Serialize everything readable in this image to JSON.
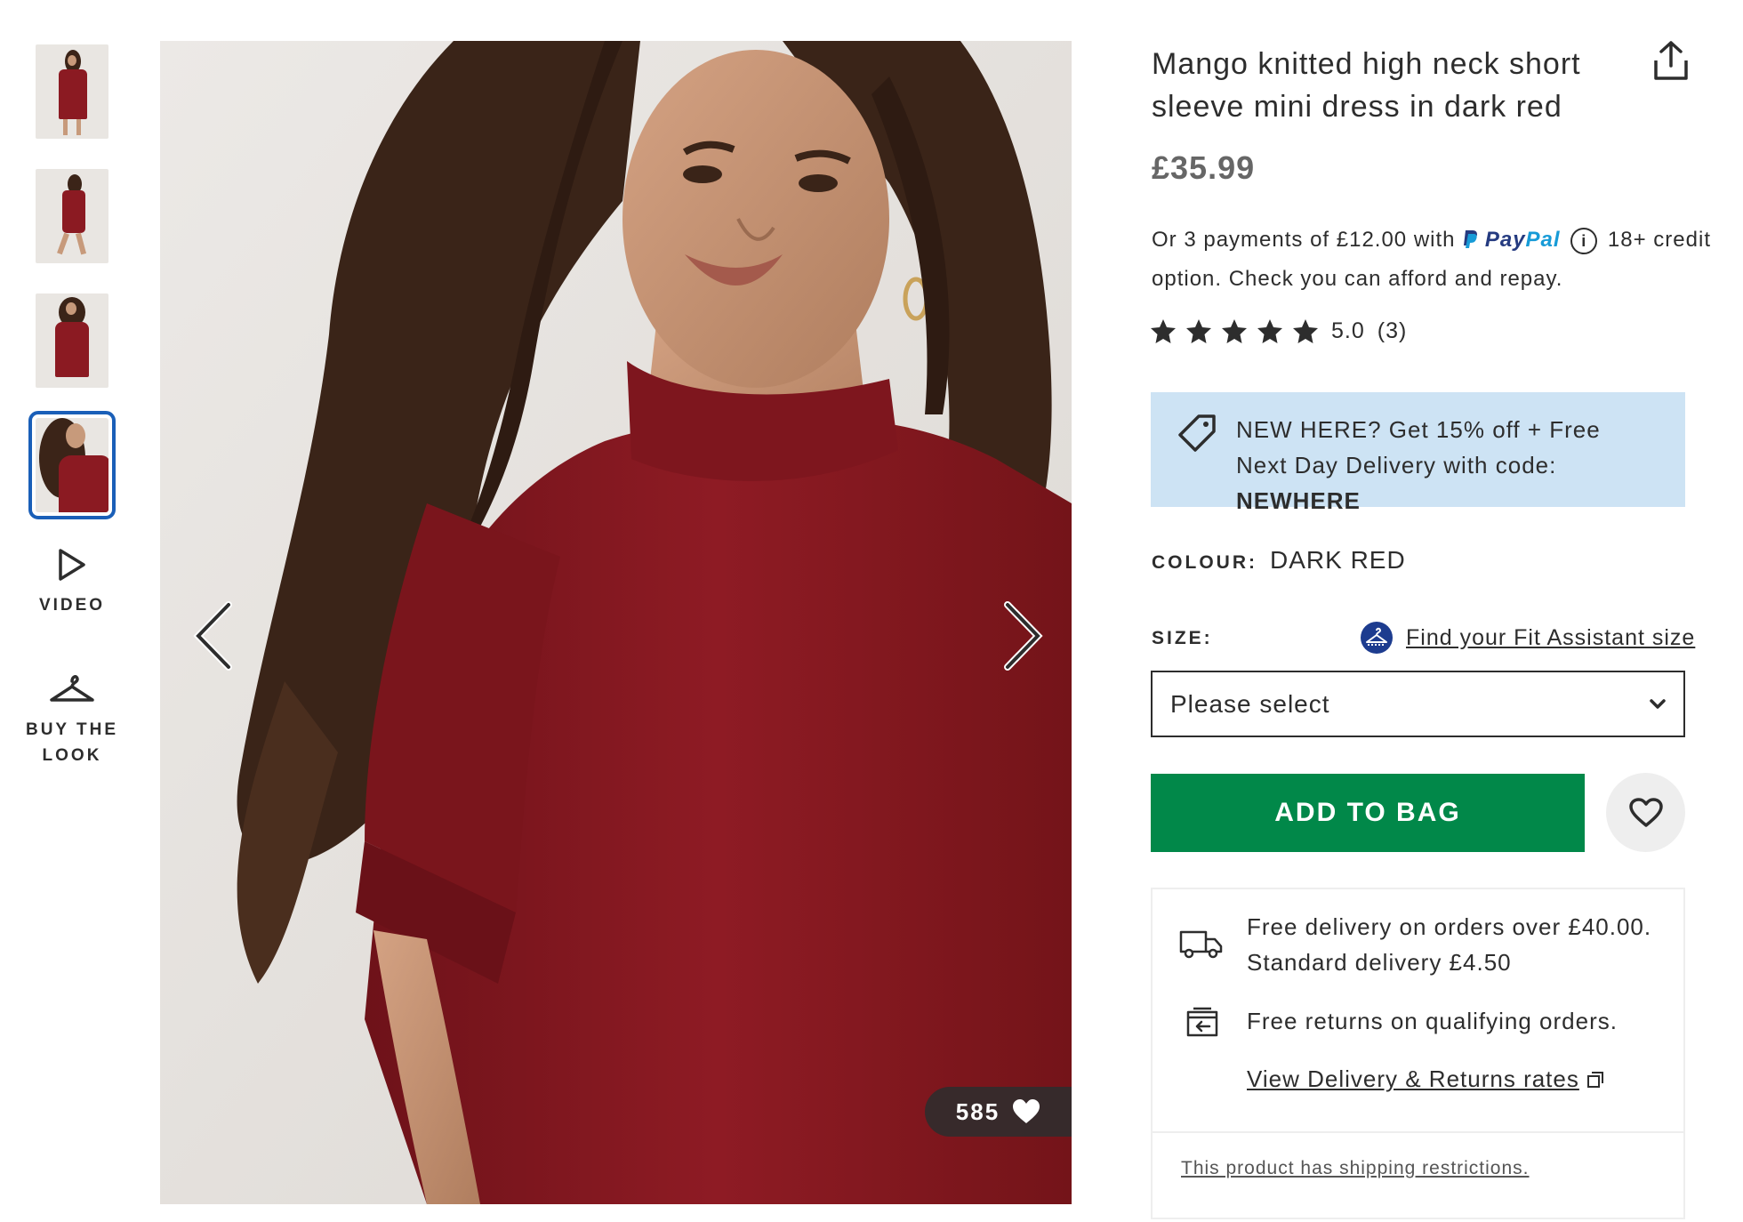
{
  "gallery": {
    "thumbnails": [
      {
        "alt": "thumbnail-1"
      },
      {
        "alt": "thumbnail-2"
      },
      {
        "alt": "thumbnail-3"
      },
      {
        "alt": "thumbnail-4"
      }
    ],
    "video_label": "VIDEO",
    "buy_the_look_line1": "BUY THE",
    "buy_the_look_line2": "LOOK",
    "like_count": "585"
  },
  "product": {
    "title": "Mango knitted high neck short sleeve mini dress in dark red",
    "price": "£35.99",
    "paypal_prefix": "Or 3 payments of £12.00 with",
    "paypal_brand_a": "Pay",
    "paypal_brand_b": "Pal",
    "paypal_info": "i",
    "paypal_suffix": "18+ credit option. Check you can afford and repay.",
    "rating_value": "5.0",
    "rating_count": "(3)",
    "stars": 5
  },
  "promo": {
    "text": "NEW HERE? Get 15% off + Free Next Day Delivery with code:",
    "code": "NEWHERE"
  },
  "colour": {
    "label": "COLOUR:",
    "value": "DARK RED"
  },
  "size": {
    "label": "SIZE:",
    "fit_link": "Find your Fit Assistant size",
    "placeholder": "Please select"
  },
  "actions": {
    "add_to_bag": "ADD TO BAG"
  },
  "delivery": {
    "line1": "Free delivery on orders over £40.00.",
    "line2": "Standard delivery £4.50",
    "returns": "Free returns on qualifying orders.",
    "view_link": "View Delivery & Returns rates",
    "restrictions": "This product has shipping restrictions."
  },
  "colors": {
    "add_to_bag_bg": "#018849",
    "promo_bg": "#cde3f4",
    "active_thumb_border": "#1a5fb8",
    "dress": "#8b1a22"
  }
}
